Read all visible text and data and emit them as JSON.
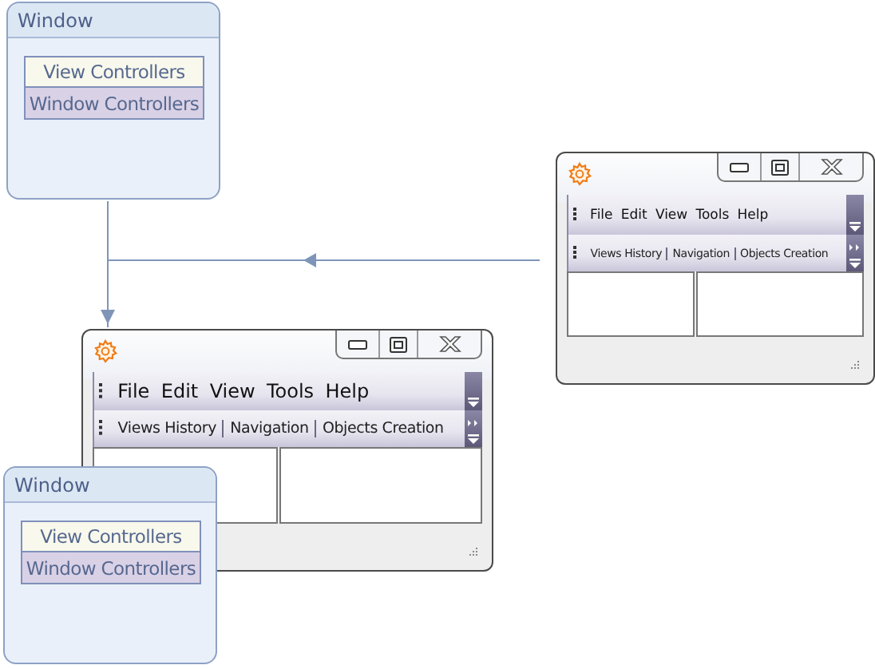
{
  "diagram_nodes": [
    {
      "title": "Window",
      "items": [
        {
          "label": "View Controllers",
          "kind": "view"
        },
        {
          "label": "Window Controllers",
          "kind": "window"
        }
      ]
    },
    {
      "title": "Window",
      "items": [
        {
          "label": "View Controllers",
          "kind": "view"
        },
        {
          "label": "Window Controllers",
          "kind": "window"
        }
      ]
    }
  ],
  "app_windows": [
    {
      "menu": [
        "File",
        "Edit",
        "View",
        "Tools",
        "Help"
      ],
      "toolbar": [
        "Views History",
        "Navigation",
        "Objects Creation"
      ]
    },
    {
      "menu": [
        "File",
        "Edit",
        "View",
        "Tools",
        "Help"
      ],
      "toolbar": [
        "Views History",
        "Navigation",
        "Objects Creation"
      ]
    }
  ]
}
